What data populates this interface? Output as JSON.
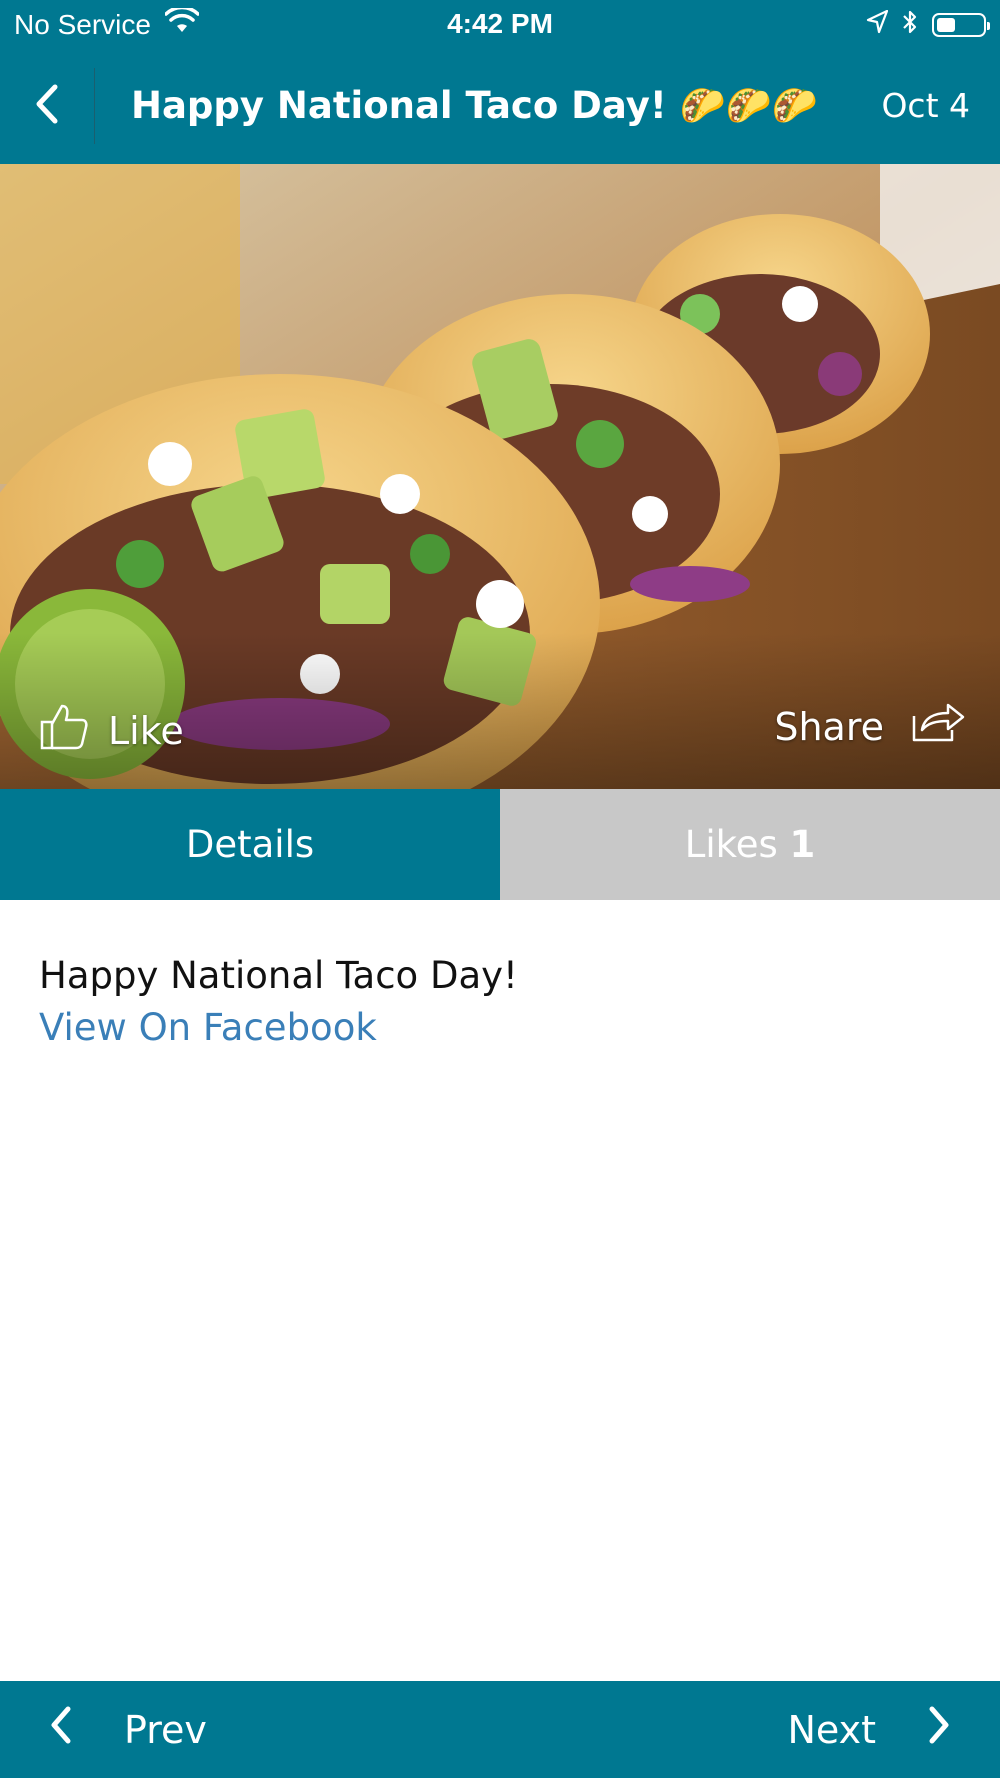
{
  "status_bar": {
    "carrier": "No Service",
    "time": "4:42 PM",
    "battery_level": 0.4,
    "icons": [
      "wifi-icon",
      "location-arrow-icon",
      "bluetooth-icon",
      "battery-icon"
    ]
  },
  "header": {
    "title": "Happy National Taco Day! 🌮🌮🌮",
    "date": "Oct 4",
    "back_icon": "chevron-left-icon"
  },
  "hero": {
    "image_subject": "tacos-photo",
    "like_label": "Like",
    "like_icon": "thumbs-up-icon",
    "share_label": "Share",
    "share_icon": "share-arrow-icon"
  },
  "tabs": {
    "details_label": "Details",
    "likes_label": "Likes",
    "likes_count": "1"
  },
  "post": {
    "text": "Happy National Taco Day!",
    "link_label": "View On Facebook"
  },
  "footer": {
    "prev_label": "Prev",
    "next_label": "Next"
  },
  "colors": {
    "brand_teal": "#007891",
    "inactive_tab": "#c8c8c8",
    "link_blue": "#3a7fb8"
  }
}
